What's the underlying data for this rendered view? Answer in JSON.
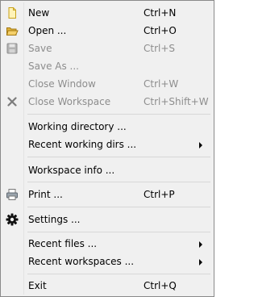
{
  "menu": {
    "items": [
      {
        "label": "New",
        "shortcut": "Ctrl+N",
        "icon": "new-document-icon"
      },
      {
        "label": "Open ...",
        "shortcut": "Ctrl+O",
        "icon": "open-folder-icon"
      },
      {
        "label": "Save",
        "shortcut": "Ctrl+S",
        "icon": "save-disk-icon"
      },
      {
        "label": "Save As ...",
        "shortcut": ""
      },
      {
        "label": "Close Window",
        "shortcut": "Ctrl+W"
      },
      {
        "label": "Close Workspace",
        "shortcut": "Ctrl+Shift+W",
        "icon": "close-x-icon"
      },
      {
        "label": "Working directory ...",
        "shortcut": ""
      },
      {
        "label": "Recent working dirs ...",
        "shortcut": ""
      },
      {
        "label": "Workspace info ...",
        "shortcut": ""
      },
      {
        "label": "Print ...",
        "shortcut": "Ctrl+P",
        "icon": "printer-icon"
      },
      {
        "label": "Settings ...",
        "shortcut": "",
        "icon": "gear-icon"
      },
      {
        "label": "Recent files ...",
        "shortcut": ""
      },
      {
        "label": "Recent workspaces ...",
        "shortcut": ""
      },
      {
        "label": "Exit",
        "shortcut": "Ctrl+Q"
      }
    ]
  }
}
